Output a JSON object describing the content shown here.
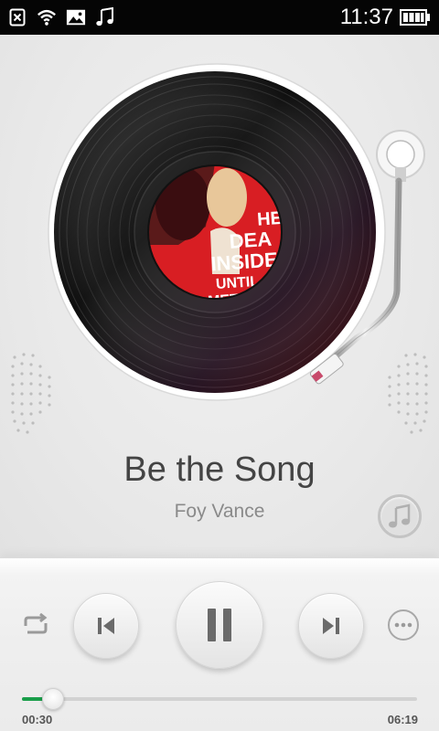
{
  "status_bar": {
    "icons": [
      "sim-card-error-icon",
      "wifi-icon",
      "image-icon",
      "music-note-icon"
    ],
    "clock": "11:37",
    "battery_icon": "battery-icon"
  },
  "album_art": {
    "label_lines": [
      "HE",
      "DEA",
      "INSIDE",
      "UNTIL",
      "MET T"
    ]
  },
  "song": {
    "title": "Be the Song",
    "artist": "Foy Vance"
  },
  "controls": {
    "repeat_icon": "repeat-icon",
    "prev_icon": "skip-previous-icon",
    "pause_icon": "pause-icon",
    "next_icon": "skip-next-icon",
    "more_icon": "more-icon",
    "library_icon": "music-note-icon"
  },
  "progress": {
    "elapsed": "00:30",
    "total": "06:19",
    "fraction": 0.079
  },
  "colors": {
    "accent": "#1a9e4a",
    "label_red": "#d81e23"
  }
}
